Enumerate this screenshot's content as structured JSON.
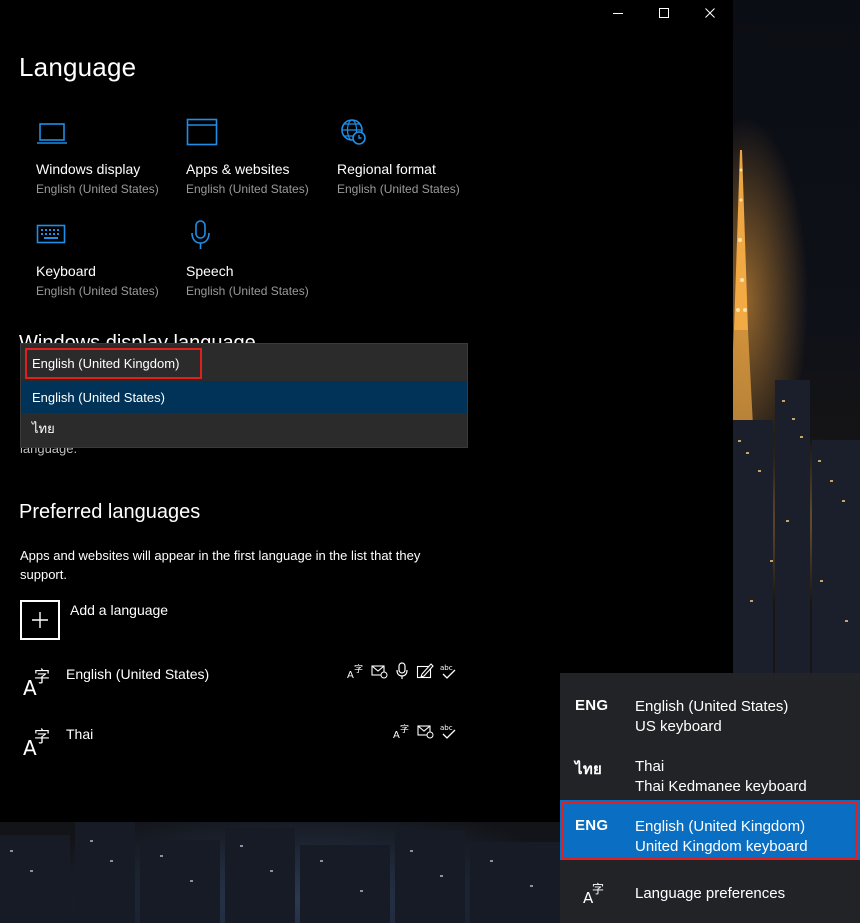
{
  "window": {
    "title": "Language",
    "controls": {
      "minimize": "—",
      "maximize": "☐",
      "close": "✕"
    }
  },
  "tiles": [
    {
      "label": "Windows display",
      "sub": "English (United States)",
      "icon": "monitor-icon"
    },
    {
      "label": "Apps & websites",
      "sub": "English (United States)",
      "icon": "browser-window-icon"
    },
    {
      "label": "Regional format",
      "sub": "English (United States)",
      "icon": "globe-clock-icon"
    },
    {
      "label": "Keyboard",
      "sub": "English (United States)",
      "icon": "keyboard-icon"
    },
    {
      "label": "Speech",
      "sub": "English (United States)",
      "icon": "microphone-icon"
    }
  ],
  "windows_display_language": {
    "section_title": "Windows display language",
    "desc_tail": "language.",
    "dropdown_options": [
      "English (United Kingdom)",
      "English (United States)",
      "ไทย"
    ],
    "selected_index": 1,
    "highlighted_option": "English (United Kingdom)"
  },
  "preferred_languages": {
    "title": "Preferred languages",
    "description": "Apps and websites will appear in the first language in the list that they support.",
    "add_label": "Add a language",
    "languages": [
      {
        "name": "English (United States)",
        "features": [
          "display-language-icon",
          "text-to-speech-icon",
          "speech-recognition-icon",
          "handwriting-icon",
          "spelling-icon"
        ]
      },
      {
        "name": "Thai",
        "features": [
          "display-language-icon",
          "text-to-speech-icon",
          "spelling-icon"
        ]
      }
    ]
  },
  "input_flyout": {
    "items": [
      {
        "code": "ENG",
        "language": "English (United States)",
        "keyboard": "US keyboard"
      },
      {
        "code": "ไทย",
        "language": "Thai",
        "keyboard": "Thai Kedmanee keyboard"
      },
      {
        "code": "ENG",
        "language": "English (United Kingdom)",
        "keyboard": "United Kingdom keyboard"
      }
    ],
    "active_index": 2,
    "preferences_label": "Language preferences"
  },
  "colors": {
    "accent": "#0078d7",
    "flyout_active": "#0a6fc2",
    "dropdown_selected": "#003357",
    "highlight_frame": "#e0201e"
  }
}
